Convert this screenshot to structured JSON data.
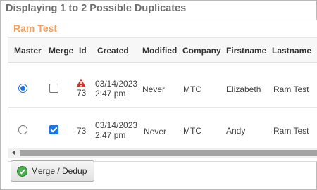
{
  "header": {
    "title": "Displaying 1 to 2 Possible Duplicates"
  },
  "group": {
    "title": "Ram Test"
  },
  "columns": {
    "master": "Master",
    "merge": "Merge",
    "id": "Id",
    "created": "Created",
    "modified": "Modified",
    "company": "Company",
    "firstname": "Firstname",
    "lastname": "Lastname"
  },
  "rows": [
    {
      "master_selected": true,
      "merge_checked": false,
      "warning_icon": "warning-triangle-icon",
      "id": "73",
      "created_date": "03/14/2023",
      "created_time": "2:47 pm",
      "modified": "Never",
      "company": "MTC",
      "firstname": "Elizabeth",
      "lastname": "Ram Test"
    },
    {
      "master_selected": false,
      "merge_checked": true,
      "id": "73",
      "created_date": "03/14/2023",
      "created_time": "2:47 pm",
      "modified": "Never",
      "company": "MTC",
      "firstname": "Andy",
      "lastname": "Ram Test"
    }
  ],
  "actions": {
    "merge_label": "Merge / Dedup",
    "merge_icon": "check-circle-icon"
  },
  "colors": {
    "group_title": "#f0a060",
    "accent": "#1a73e8",
    "warning": "#c0392b",
    "button_icon": "#4caf50"
  }
}
